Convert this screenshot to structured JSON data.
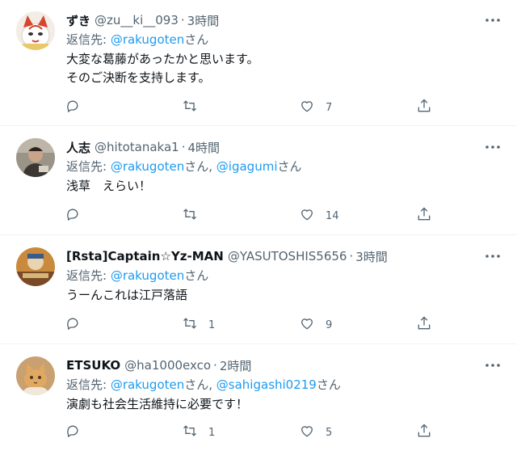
{
  "reply_prefix": "返信先: ",
  "tweets": [
    {
      "name": "ずき",
      "handle": "@zu__ki__093",
      "sep": "·",
      "time": "3時間",
      "reply_to": [
        "@rakugoten"
      ],
      "reply_joiner": ", ",
      "san": "さん",
      "lines": [
        "大変な葛藤があったかと思います。",
        "そのご決断を支持します。"
      ],
      "reply_count": "",
      "retweet_count": "",
      "like_count": "7"
    },
    {
      "name": "人志",
      "handle": "@hitotanaka1",
      "sep": "·",
      "time": "4時間",
      "reply_to": [
        "@rakugoten",
        "@igagumi"
      ],
      "san": "さん",
      "lines": [
        "浅草　えらい！"
      ],
      "reply_count": "",
      "retweet_count": "",
      "like_count": "14"
    },
    {
      "name": "[Rsta]Captain☆Yz-MAN",
      "handle": "@YASUTOSHIS5656",
      "sep": "·",
      "time": "3時間",
      "reply_to": [
        "@rakugoten"
      ],
      "san": "さん",
      "lines": [
        "うーんこれは江戸落語"
      ],
      "reply_count": "",
      "retweet_count": "1",
      "like_count": "9"
    },
    {
      "name": "ETSUKO",
      "handle": "@ha1000exco",
      "sep": "·",
      "time": "2時間",
      "reply_to": [
        "@rakugoten",
        "@sahigashi0219"
      ],
      "san": "さん",
      "lines": [
        "演劇も社会生活維持に必要です！"
      ],
      "reply_count": "",
      "retweet_count": "1",
      "like_count": "5"
    }
  ],
  "colors": {
    "accent": "#1d9bf0",
    "secondary": "#536471",
    "divider": "#eff3f4"
  },
  "icons": [
    "more-icon",
    "reply-icon",
    "retweet-icon",
    "like-icon",
    "share-icon"
  ]
}
